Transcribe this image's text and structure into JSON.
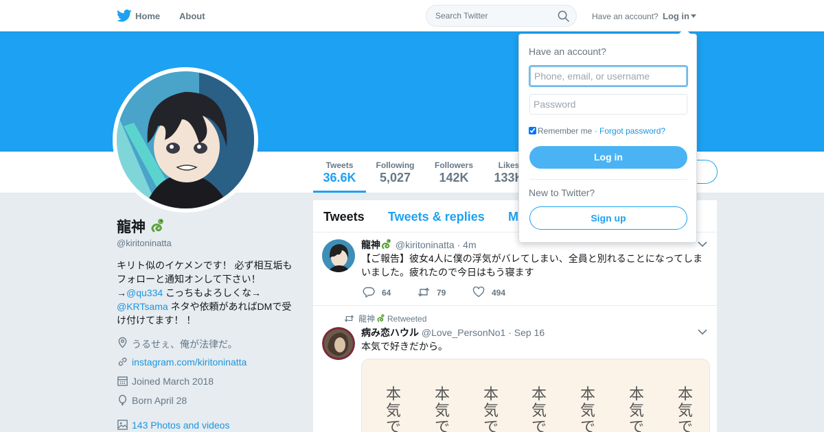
{
  "nav": {
    "home_label": "Home",
    "about_label": "About",
    "search_placeholder": "Search Twitter",
    "have_account": "Have an account?",
    "login_label": "Log in"
  },
  "colors": {
    "brand": "#1da1f2",
    "link": "#1b95e0",
    "muted": "#657786",
    "background": "#e6ecf0"
  },
  "profile": {
    "name": "龍神",
    "handle": "@kiritoninatta",
    "bio": {
      "line1": "キリト似のイケメンです！ 必ず相互垢もフォローと通知オンして下さい！",
      "arrow1": "→",
      "mention1": "@qu334",
      "text2": " こっちもよろしくな→",
      "mention2": "@KRTsama",
      "text3": " ネタや依頼があればDMで受け付けてます！ ！"
    },
    "location": "うるせぇ、俺が法律だ。",
    "website": "instagram.com/kiritoninatta",
    "joined": "Joined March 2018",
    "born": "Born April 28",
    "photos": "143 Photos and videos"
  },
  "stats": [
    {
      "label": "Tweets",
      "value": "36.6K"
    },
    {
      "label": "Following",
      "value": "5,027"
    },
    {
      "label": "Followers",
      "value": "142K"
    },
    {
      "label": "Likes",
      "value": "133K"
    }
  ],
  "timeline": {
    "tabs": {
      "tweets": "Tweets",
      "replies": "Tweets & replies",
      "media": "M"
    },
    "tweet1": {
      "name": "龍神",
      "handle": "@kiritoninatta",
      "dot": "·",
      "time": "4m",
      "text": "【ご報告】彼女4人に僕の浮気がバレてしまい、全員と別れることになってしまいました。疲れたので今日はもう寝ます",
      "replies": "64",
      "retweets": "79",
      "likes": "494"
    },
    "tweet2": {
      "retweeted_by": "龍神",
      "retweeted_label": "Retweeted",
      "name": "病み恋ハウル",
      "handle": "@Love_PersonNo1",
      "dot": "·",
      "time": "Sep 16",
      "text": "本気で好きだから。",
      "media_columns": [
        "本気で",
        "本気で",
        "本気で",
        "本気で",
        "本気で",
        "本気で",
        "本気で"
      ]
    }
  },
  "login_dropdown": {
    "title": "Have an account?",
    "username_placeholder": "Phone, email, or username",
    "password_placeholder": "Password",
    "remember_label": "Remember me",
    "separator": "·",
    "forgot_label": "Forgot password?",
    "login_button": "Log in",
    "new_label": "New to Twitter?",
    "signup_button": "Sign up"
  }
}
